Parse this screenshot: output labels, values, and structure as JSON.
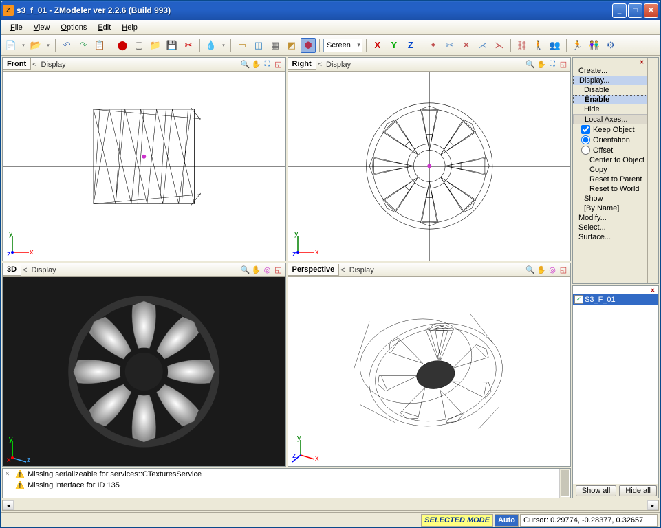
{
  "window": {
    "title": "s3_f_01 - ZModeler ver 2.2.6 (Build 993)"
  },
  "menubar": {
    "file": "File",
    "view": "View",
    "options": "Options",
    "edit": "Edit",
    "help": "Help"
  },
  "toolbar": {
    "combo_value": "Screen",
    "axis": {
      "x": "X",
      "y": "Y",
      "z": "Z"
    }
  },
  "viewports": {
    "front": {
      "name": "Front",
      "nav": "<",
      "display": "Display"
    },
    "right": {
      "name": "Right",
      "nav": "<",
      "display": "Display"
    },
    "view3d": {
      "name": "3D",
      "nav": "<",
      "display": "Display"
    },
    "perspective": {
      "name": "Perspective",
      "nav": "<",
      "display": "Display"
    }
  },
  "console": {
    "line1": "Missing serializeable for services::CTexturesService",
    "line2": "Missing interface for ID 135"
  },
  "sidepanel": {
    "create": "Create...",
    "display": "Display...",
    "disable": "Disable",
    "enable": "Enable",
    "hide": "Hide",
    "local_axes": "Local Axes...",
    "keep_object": "Keep Object",
    "orientation": "Orientation",
    "offset": "Offset",
    "center": "Center to Object",
    "copy": "Copy",
    "reset_parent": "Reset to Parent",
    "reset_world": "Reset to World",
    "show": "Show",
    "by_name": "[By Name]",
    "modify": "Modify...",
    "select": "Select...",
    "surface": "Surface..."
  },
  "objects": {
    "item1": "S3_F_01",
    "show_all": "Show all",
    "hide_all": "Hide all"
  },
  "status": {
    "selmode": "SELECTED MODE",
    "auto": "Auto",
    "cursor": "Cursor: 0.29774, -0.28377, 0.32657"
  }
}
